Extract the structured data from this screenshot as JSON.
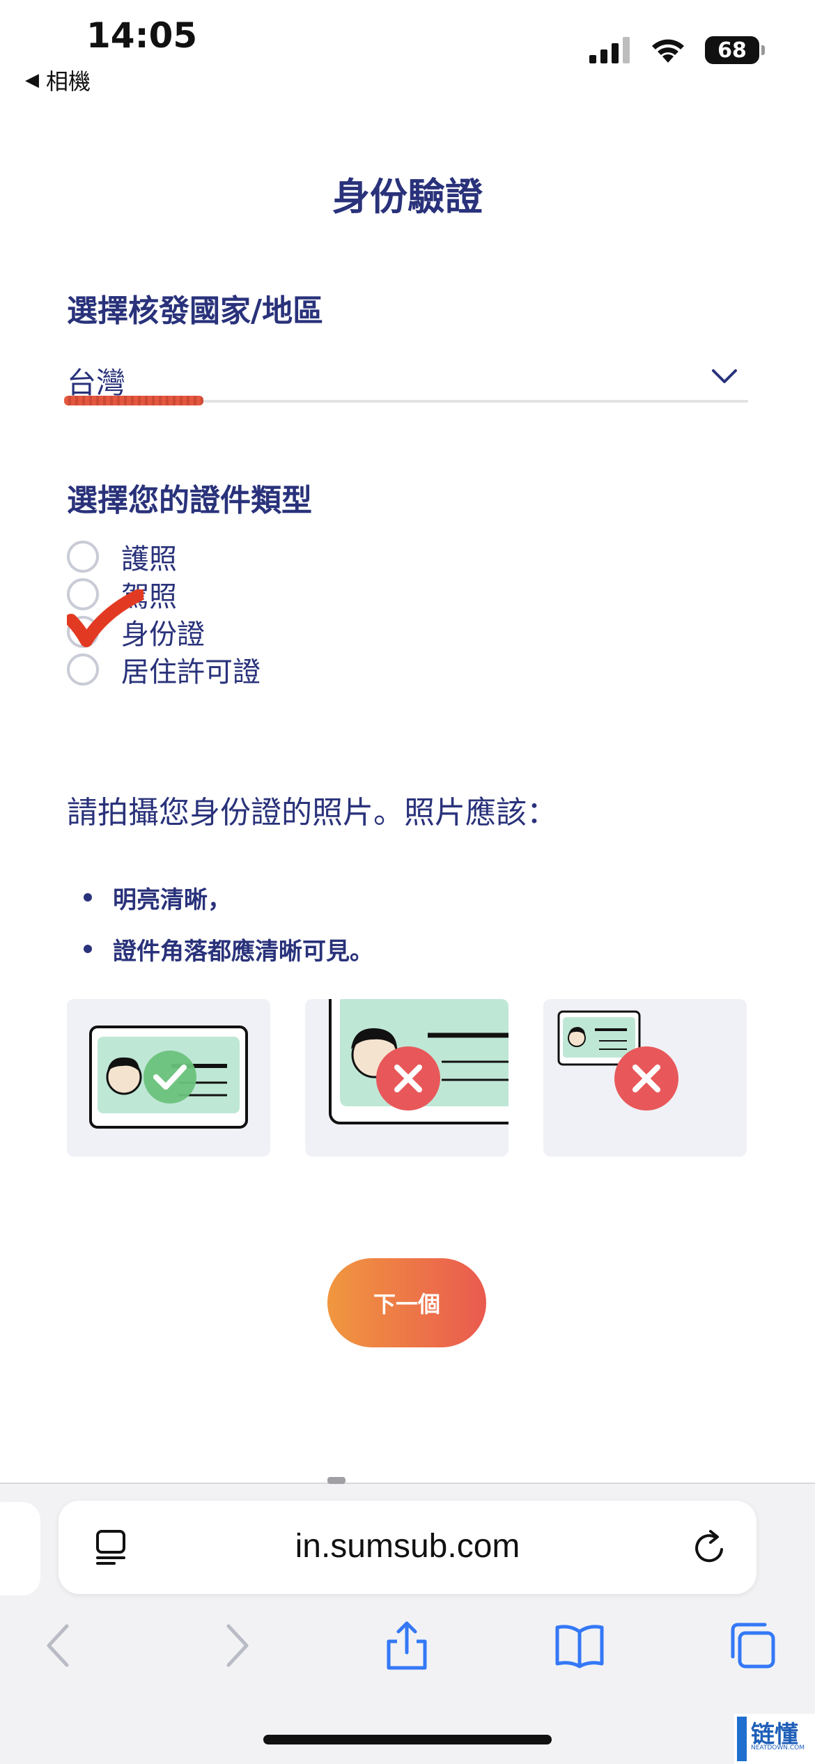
{
  "status_bar": {
    "time": "14:05",
    "back_label": "相機",
    "battery": "68",
    "icons": [
      "signal-icon",
      "wifi-icon",
      "battery-icon"
    ]
  },
  "page": {
    "title": "身份驗證",
    "country_heading": "選擇核發國家/地區",
    "country_value": "台灣",
    "doc_type_heading": "選擇您的證件類型",
    "doc_types": [
      {
        "label": "護照",
        "selected": false
      },
      {
        "label": "駕照",
        "selected": false
      },
      {
        "label": "身份證",
        "selected": true
      },
      {
        "label": "居住許可證",
        "selected": false
      }
    ],
    "instruction": "請拍攝您身份證的照片。照片應該：",
    "bullets": [
      "明亮清晰，",
      "證件角落都應清晰可見。"
    ],
    "examples": [
      {
        "status": "good",
        "icon": "check-icon"
      },
      {
        "status": "bad",
        "icon": "x-icon"
      },
      {
        "status": "bad",
        "icon": "x-icon"
      }
    ],
    "next_label": "下一個"
  },
  "browser": {
    "url": "in.sumsub.com",
    "toolbar": [
      "back-icon",
      "forward-icon",
      "share-icon",
      "bookmarks-icon",
      "tabs-icon"
    ]
  },
  "watermark": {
    "text": "链懂",
    "sub": "NEATDOWN.COM"
  },
  "colors": {
    "primary_text": "#29327a",
    "button_start": "#f0973f",
    "button_end": "#ea5a4f",
    "ios_blue": "#3478f6",
    "good": "#6cc27c",
    "bad": "#e8585a"
  }
}
